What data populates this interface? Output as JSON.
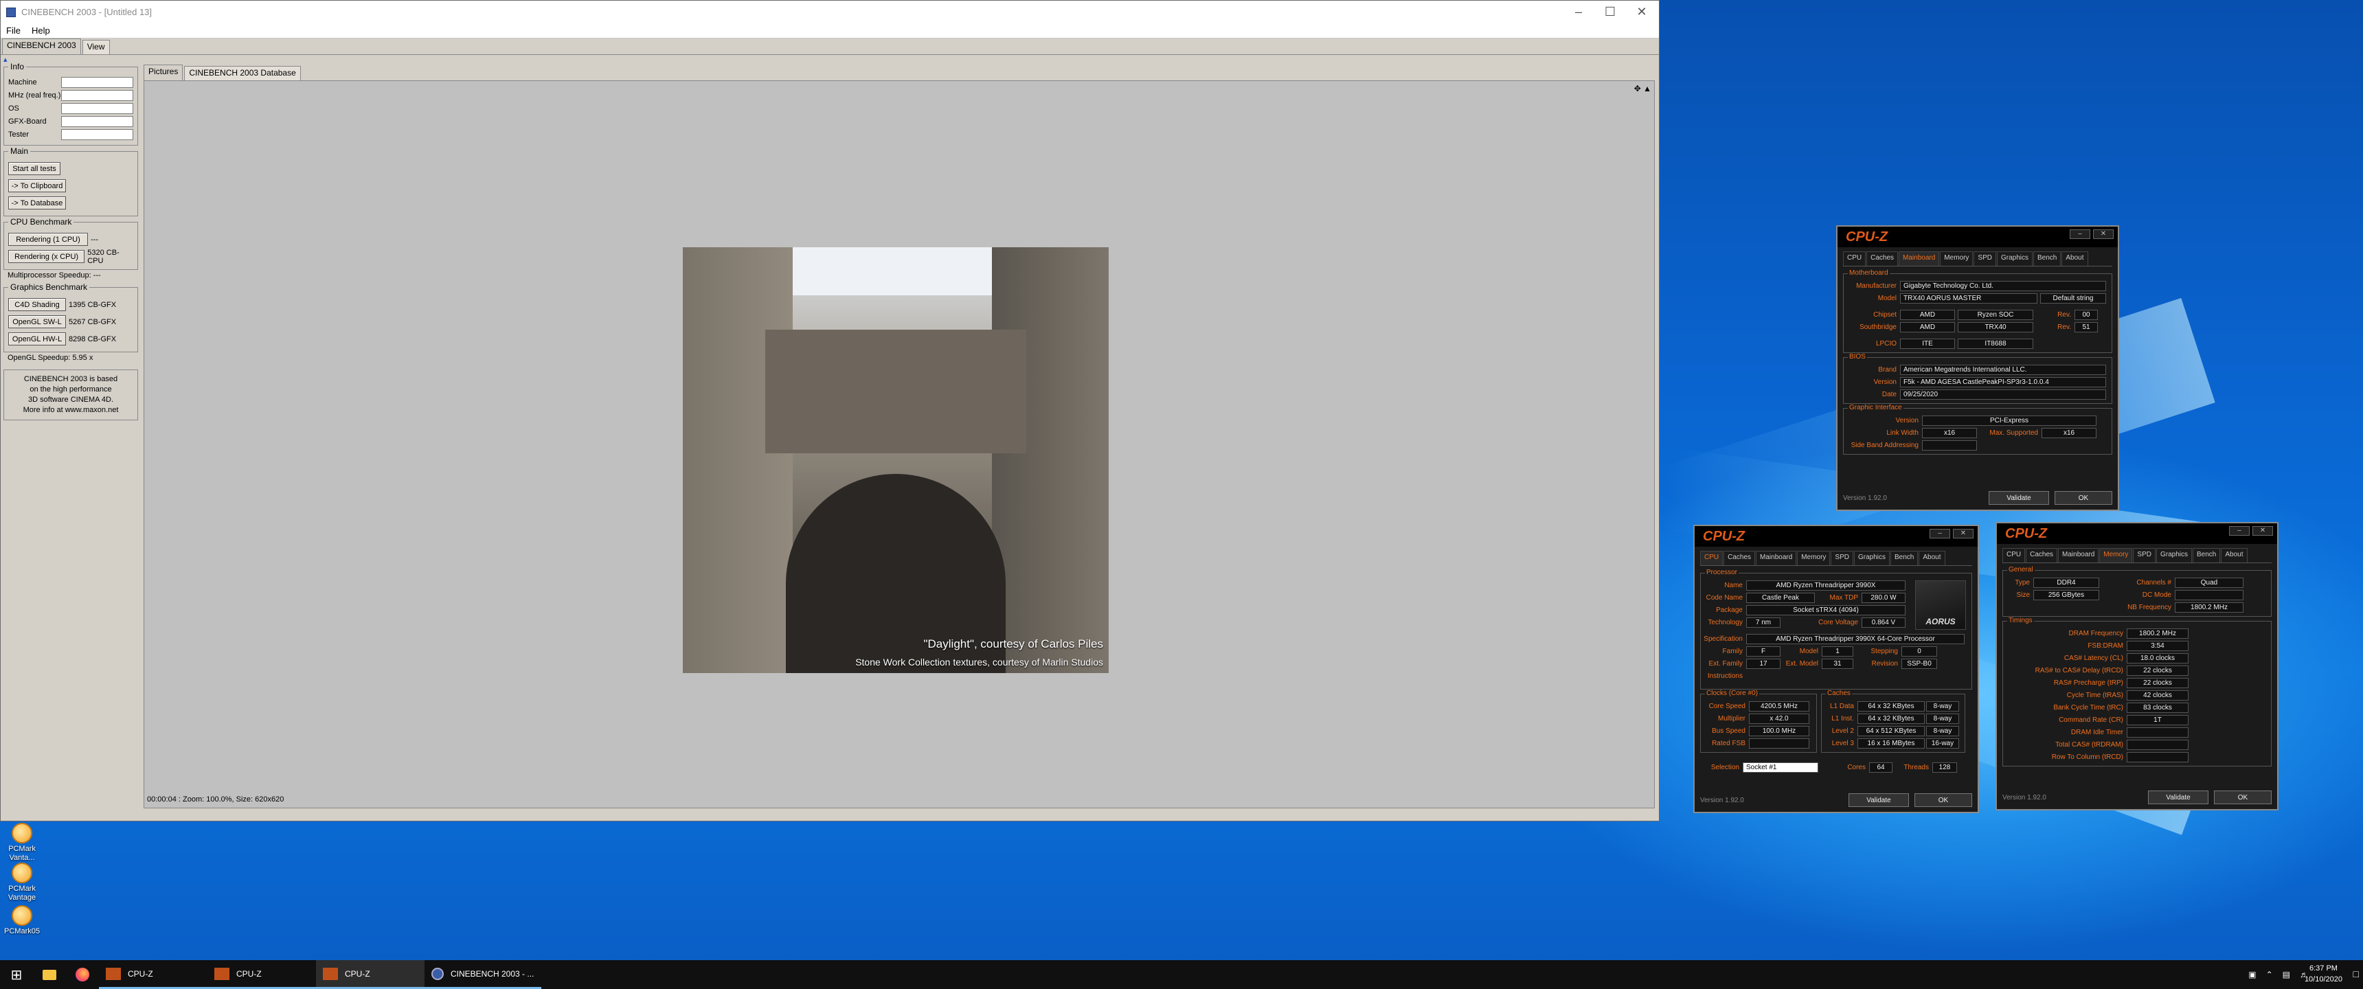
{
  "cinebench": {
    "title": "CINEBENCH 2003 - [Untitled 13]",
    "menu": [
      "File",
      "Help"
    ],
    "tabs": [
      "CINEBENCH 2003",
      "View"
    ],
    "info": {
      "legend": "Info",
      "fields": [
        "Machine",
        "MHz (real freq.)",
        "OS",
        "GFX-Board",
        "Tester"
      ]
    },
    "main": {
      "legend": "Main",
      "start_all": "Start all tests",
      "to_clipboard": "-> To Clipboard",
      "to_database": "-> To Database"
    },
    "cpu": {
      "legend": "CPU Benchmark",
      "rows": [
        {
          "label": "Rendering (1 CPU)",
          "value": "---"
        },
        {
          "label": "Rendering (x CPU)",
          "value": "5320 CB-CPU"
        }
      ],
      "mp_speedup": "Multiprocessor Speedup:  ---"
    },
    "gfx": {
      "legend": "Graphics Benchmark",
      "rows": [
        {
          "label": "C4D Shading",
          "value": "1395 CB-GFX"
        },
        {
          "label": "OpenGL SW-L",
          "value": "5267 CB-GFX"
        },
        {
          "label": "OpenGL HW-L",
          "value": "8298 CB-GFX"
        }
      ],
      "ogl_speedup": "OpenGL Speedup:  5.95 x"
    },
    "note": [
      "CINEBENCH 2003 is based",
      "on the high performance",
      "3D software CINEMA 4D.",
      "More info at www.maxon.net"
    ],
    "right_tabs": [
      "Pictures",
      "CINEBENCH 2003 Database"
    ],
    "status": "00:00:04 : Zoom: 100.0%, Size: 620x620",
    "caption1": "\"Daylight\", courtesy of Carlos Piles",
    "caption2": "Stone Work Collection textures, courtesy of Marlin Studios"
  },
  "cpuz_mainboard": {
    "logo": "CPU-Z",
    "tabs": [
      "CPU",
      "Caches",
      "Mainboard",
      "Memory",
      "SPD",
      "Graphics",
      "Bench",
      "About"
    ],
    "active_tab": "Mainboard",
    "motherboard": {
      "title": "Motherboard",
      "manufacturer_label": "Manufacturer",
      "manufacturer": "Gigabyte Technology Co. Ltd.",
      "model_label": "Model",
      "model": "TRX40 AORUS MASTER",
      "model_btn": "Default string",
      "chipset_label": "Chipset",
      "chipset_vendor": "AMD",
      "chipset_name": "Ryzen SOC",
      "chipset_rev_label": "Rev.",
      "chipset_rev": "00",
      "southbridge_label": "Southbridge",
      "sb_vendor": "AMD",
      "sb_name": "TRX40",
      "sb_rev_label": "Rev.",
      "sb_rev": "51",
      "lpcio_label": "LPCIO",
      "lpcio_vendor": "ITE",
      "lpcio_name": "IT8688"
    },
    "bios": {
      "title": "BIOS",
      "brand_label": "Brand",
      "brand": "American Megatrends International LLC.",
      "version_label": "Version",
      "version": "F5k - AMD AGESA CastlePeakPI-SP3r3-1.0.0.4",
      "date_label": "Date",
      "date": "09/25/2020"
    },
    "graphic": {
      "title": "Graphic Interface",
      "version_label": "Version",
      "version": "PCI-Express",
      "link_label": "Link Width",
      "link": "x16",
      "max_label": "Max. Supported",
      "max": "x16",
      "sba_label": "Side Band Addressing"
    },
    "version": "Version 1.92.0",
    "validate": "Validate",
    "ok": "OK"
  },
  "cpuz_cpu": {
    "logo": "CPU-Z",
    "tabs": [
      "CPU",
      "Caches",
      "Mainboard",
      "Memory",
      "SPD",
      "Graphics",
      "Bench",
      "About"
    ],
    "active_tab": "CPU",
    "processor_title": "Processor",
    "name_label": "Name",
    "name": "AMD Ryzen Threadripper 3990X",
    "codename_label": "Code Name",
    "codename": "Castle Peak",
    "maxtdp_label": "Max TDP",
    "maxtdp": "280.0 W",
    "package_label": "Package",
    "package": "Socket sTRX4 (4094)",
    "tech_label": "Technology",
    "tech": "7 nm",
    "voltage_label": "Core Voltage",
    "voltage": "0.864 V",
    "spec_label": "Specification",
    "spec": "AMD Ryzen Threadripper 3990X 64-Core Processor",
    "family_label": "Family",
    "family": "F",
    "model_label": "Model",
    "model": "1",
    "stepping_label": "Stepping",
    "stepping": "0",
    "extfamily_label": "Ext. Family",
    "extfamily": "17",
    "extmodel_label": "Ext. Model",
    "extmodel": "31",
    "revision_label": "Revision",
    "revision": "SSP-B0",
    "instructions_label": "Instructions",
    "clocks_title": "Clocks (Core #0)",
    "corespeed_label": "Core Speed",
    "corespeed": "4200.5 MHz",
    "multiplier_label": "Multiplier",
    "multiplier": "x 42.0",
    "busspeed_label": "Bus Speed",
    "busspeed": "100.0 MHz",
    "ratedfsb_label": "Rated FSB",
    "caches_title": "Caches",
    "caches": [
      {
        "label": "L1 Data",
        "size": "64 x 32 KBytes",
        "way": "8-way"
      },
      {
        "label": "L1 Inst.",
        "size": "64 x 32 KBytes",
        "way": "8-way"
      },
      {
        "label": "Level 2",
        "size": "64 x 512 KBytes",
        "way": "8-way"
      },
      {
        "label": "Level 3",
        "size": "16 x 16 MBytes",
        "way": "16-way"
      }
    ],
    "selection_label": "Selection",
    "selection": "Socket #1",
    "cores_label": "Cores",
    "cores": "64",
    "threads_label": "Threads",
    "threads": "128",
    "version": "Version 1.92.0",
    "validate": "Validate",
    "ok": "OK"
  },
  "cpuz_memory": {
    "logo": "CPU-Z",
    "tabs": [
      "CPU",
      "Caches",
      "Mainboard",
      "Memory",
      "SPD",
      "Graphics",
      "Bench",
      "About"
    ],
    "active_tab": "Memory",
    "general_title": "General",
    "type_label": "Type",
    "type": "DDR4",
    "channels_label": "Channels #",
    "channels": "Quad",
    "size_label": "Size",
    "size": "256 GBytes",
    "dc_label": "DC Mode",
    "nb_label": "NB Frequency",
    "nb": "1800.2 MHz",
    "timings_title": "Timings",
    "timings": [
      {
        "label": "DRAM Frequency",
        "value": "1800.2 MHz"
      },
      {
        "label": "FSB:DRAM",
        "value": "3:54"
      },
      {
        "label": "CAS# Latency (CL)",
        "value": "18.0 clocks"
      },
      {
        "label": "RAS# to CAS# Delay (tRCD)",
        "value": "22 clocks"
      },
      {
        "label": "RAS# Precharge (tRP)",
        "value": "22 clocks"
      },
      {
        "label": "Cycle Time (tRAS)",
        "value": "42 clocks"
      },
      {
        "label": "Bank Cycle Time (tRC)",
        "value": "83 clocks"
      },
      {
        "label": "Command Rate (CR)",
        "value": "1T"
      },
      {
        "label": "DRAM Idle Timer",
        "value": ""
      },
      {
        "label": "Total CAS# (tRDRAM)",
        "value": ""
      },
      {
        "label": "Row To Column (tRCD)",
        "value": ""
      }
    ],
    "version": "Version 1.92.0",
    "validate": "Validate",
    "ok": "OK"
  },
  "desktop_icons": [
    "PCMark Vanta...",
    "PCMark Vantage",
    "PCMark05"
  ],
  "taskbar": {
    "apps": [
      "CPU-Z",
      "CPU-Z",
      "CPU-Z",
      "CINEBENCH 2003 - ..."
    ],
    "time": "6:37 PM",
    "date": "10/10/2020"
  },
  "colors": {
    "cpuz_accent": "#f07020",
    "taskbar_accent": "#76b9ed"
  }
}
